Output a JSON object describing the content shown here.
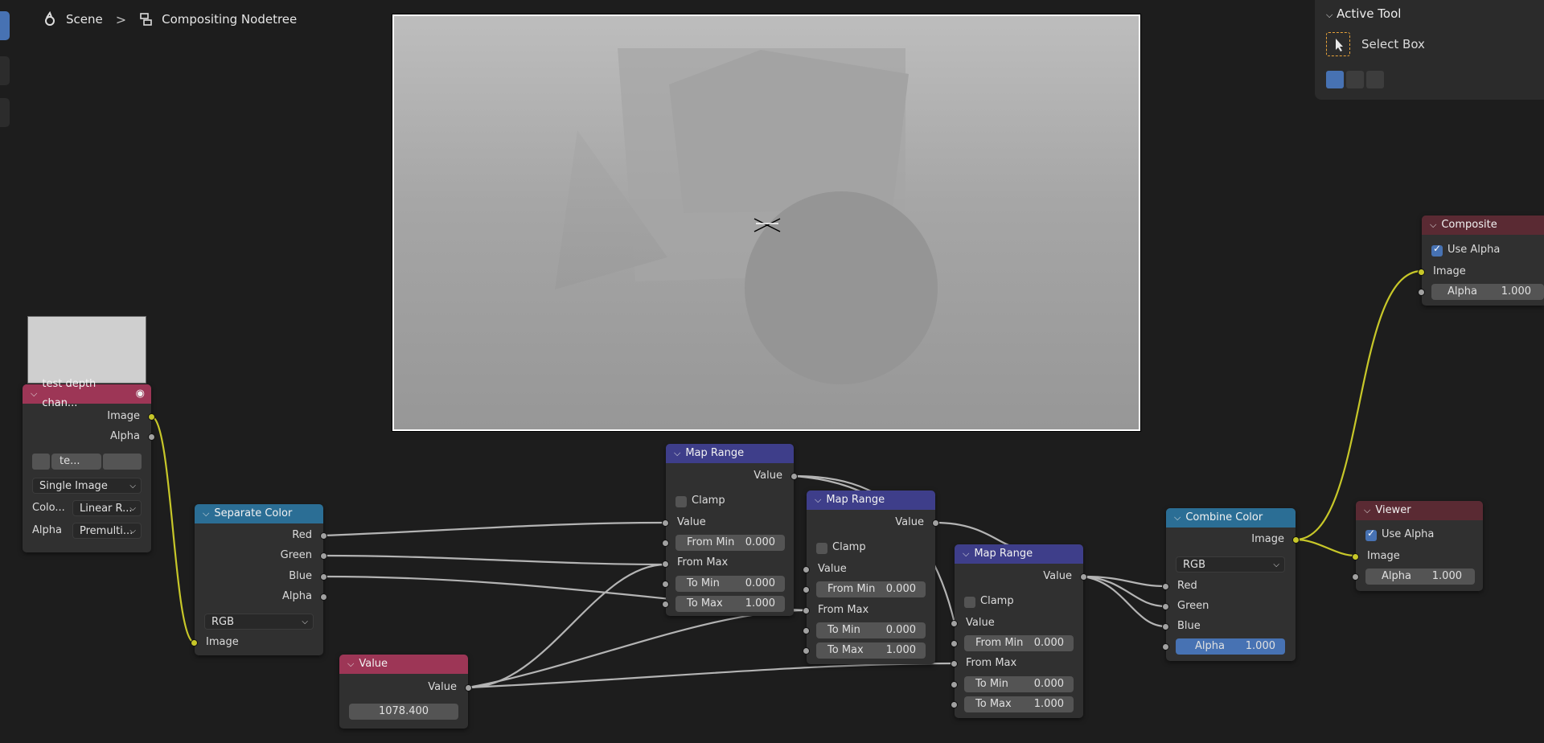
{
  "breadcrumb": {
    "scene_icon": "scene-icon",
    "scene": "Scene",
    "separator": ">",
    "tree_icon": "node-tree-icon",
    "tree": "Compositing Nodetree"
  },
  "active_tool": {
    "header": "Active Tool",
    "tool_name": "Select Box",
    "icon": "select-box-icon"
  },
  "colors": {
    "accent": "#4772b3",
    "image_socket": "#c7c729",
    "value_socket": "#a1a1a1",
    "input_header": "#9d3656",
    "converter_header": "#2b6e95",
    "map_range_header": "#3e3e8a",
    "output_header": "#5a2a33"
  },
  "image_node": {
    "title": "test depth chan...",
    "out_image": "Image",
    "out_alpha": "Alpha",
    "image_name": "te...",
    "source": "Single Image",
    "color_label": "Colo...",
    "color_value": "Linear R...",
    "alpha_label": "Alpha",
    "alpha_value": "Premulti..."
  },
  "separate_color": {
    "title": "Separate Color",
    "out_red": "Red",
    "out_green": "Green",
    "out_blue": "Blue",
    "out_alpha": "Alpha",
    "mode": "RGB",
    "in_image": "Image"
  },
  "value_node": {
    "title": "Value",
    "out_value": "Value",
    "value": "1078.400"
  },
  "map_range_1": {
    "title": "Map Range",
    "out_value": "Value",
    "clamp": "Clamp",
    "in_value": "Value",
    "from_min_label": "From Min",
    "from_min": "0.000",
    "from_max": "From Max",
    "to_min_label": "To Min",
    "to_min": "0.000",
    "to_max_label": "To Max",
    "to_max": "1.000"
  },
  "map_range_2": {
    "title": "Map Range",
    "out_value": "Value",
    "clamp": "Clamp",
    "in_value": "Value",
    "from_min_label": "From Min",
    "from_min": "0.000",
    "from_max": "From Max",
    "to_min_label": "To Min",
    "to_min": "0.000",
    "to_max_label": "To Max",
    "to_max": "1.000"
  },
  "map_range_3": {
    "title": "Map Range",
    "out_value": "Value",
    "clamp": "Clamp",
    "in_value": "Value",
    "from_min_label": "From Min",
    "from_min": "0.000",
    "from_max": "From Max",
    "to_min_label": "To Min",
    "to_min": "0.000",
    "to_max_label": "To Max",
    "to_max": "1.000"
  },
  "combine_color": {
    "title": "Combine Color",
    "out_image": "Image",
    "mode": "RGB",
    "in_red": "Red",
    "in_green": "Green",
    "in_blue": "Blue",
    "alpha_label": "Alpha",
    "alpha_value": "1.000"
  },
  "composite": {
    "title": "Composite",
    "use_alpha": "Use Alpha",
    "in_image": "Image",
    "alpha_label": "Alpha",
    "alpha_value": "1.000"
  },
  "viewer": {
    "title": "Viewer",
    "use_alpha": "Use Alpha",
    "in_image": "Image",
    "alpha_label": "Alpha",
    "alpha_value": "1.000"
  }
}
